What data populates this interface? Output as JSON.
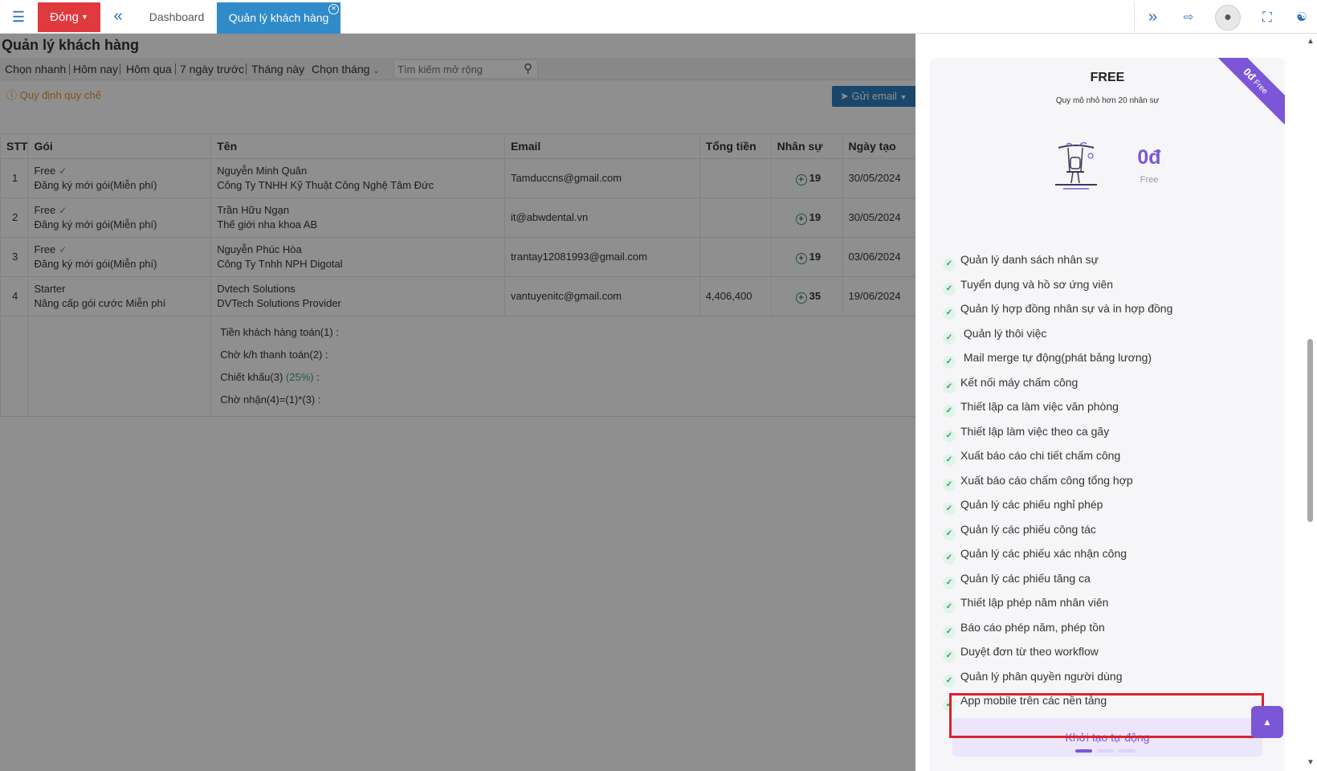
{
  "topbar": {
    "close_label": "Đóng",
    "tabs": [
      {
        "label": "Dashboard"
      },
      {
        "label": "Quản lý khách hàng"
      }
    ]
  },
  "main": {
    "title": "Quản lý khách hàng",
    "filters": [
      "Chọn nhanh",
      "Hôm nay",
      "Hôm qua",
      "7 ngày trước",
      "Tháng này"
    ],
    "month_picker": "Chọn tháng",
    "search_placeholder": "Tìm kiếm mở rộng",
    "rules_link": "Quy định quy chế",
    "send_email": "Gửi email",
    "table": {
      "headers": [
        "STT",
        "Gói",
        "Tên",
        "Email",
        "Tổng tiền",
        "Nhân sự",
        "Ngày tạo"
      ],
      "rows": [
        {
          "stt": "1",
          "plan": "Free",
          "plan_sub": "Đăng ký mới gói(Miễn phí)",
          "name": "Nguyễn Minh Quân",
          "company": "Công Ty TNHH Kỹ Thuật Công Nghệ Tâm Đức",
          "email": "Tamduccns@gmail.com",
          "total": "",
          "staff": "19",
          "created": "30/05/2024"
        },
        {
          "stt": "2",
          "plan": "Free",
          "plan_sub": "Đăng ký mới gói(Miễn phí)",
          "name": "Trần Hữu Ngạn",
          "company": "Thế giới nha khoa AB",
          "email": "it@abwdental.vn",
          "total": "",
          "staff": "19",
          "created": "30/05/2024"
        },
        {
          "stt": "3",
          "plan": "Free",
          "plan_sub": "Đăng ký mới gói(Miễn phí)",
          "name": "Nguyễn Phúc Hòa",
          "company": "Công Ty Tnhh NPH Digotal",
          "email": "trantay12081993@gmail.com",
          "total": "",
          "staff": "19",
          "created": "03/06/2024"
        },
        {
          "stt": "4",
          "plan": "Starter",
          "plan_sub": "Nâng cấp gói cước Miễn phí",
          "name": "Dvtech Solutions",
          "company": "DVTech Solutions Provider",
          "email": "vantuyenitc@gmail.com",
          "total": "4,406,400",
          "staff": "35",
          "created": "19/06/2024"
        }
      ]
    },
    "summary": {
      "line1": "Tiền khách hàng toán(1) :",
      "line2": "Chờ k/h thanh toán(2) :",
      "line3_label": "Chiết khấu(3)",
      "line3_pct": "(25%)",
      "line3_colon": ":",
      "line4": "Chờ nhận(4)=(1)*(3) :"
    }
  },
  "plan_card": {
    "ribbon_price": "0đ",
    "ribbon_label": "Free",
    "name": "FREE",
    "description": "Quy mô nhỏ hơn 20 nhân sự",
    "price": "0đ",
    "period": "Free",
    "features": [
      "Quản lý danh sách nhân sự",
      "Tuyển dụng và hồ sơ ứng viên",
      "Quản lý hợp đồng nhân sự và in hợp đồng",
      " Quản lý thôi việc",
      " Mail merge tự động(phát bảng lương)",
      "Kết nối máy chấm công",
      "Thiết lập ca làm việc văn phòng",
      "Thiết lập làm việc theo ca gãy",
      "Xuất báo cáo chi tiết chấm công",
      "Xuất báo cáo chấm công tổng hợp",
      "Quản lý các phiếu nghỉ phép",
      "Quản lý các phiếu công tác",
      "Quản lý các phiếu xác nhận công",
      "Quản lý các phiếu tăng ca",
      "Thiết lập phép năm nhân viên",
      "Báo cáo phép năm, phép tồn",
      "Duyệt đơn từ theo workflow",
      "Quản lý phân quyền người dùng",
      "App mobile trên các nền tảng"
    ],
    "cta": "Khởi tạo tự động"
  },
  "icons": {
    "menu": "hamburger-icon",
    "back": "double-chevron-left-icon",
    "forward": "double-chevron-right-icon",
    "exit": "exit-icon",
    "avatar": "user-icon",
    "fullscreen": "fullscreen-icon",
    "org": "org-chart-icon",
    "check": "check-circle-icon",
    "send": "paper-plane-icon"
  },
  "colors": {
    "close_button": "#e0393e",
    "active_tab": "#2f8bc9",
    "accent": "#7b56d6",
    "success": "#2a9b5e",
    "warning_link": "#e8912c",
    "highlight": "#d9232d"
  }
}
